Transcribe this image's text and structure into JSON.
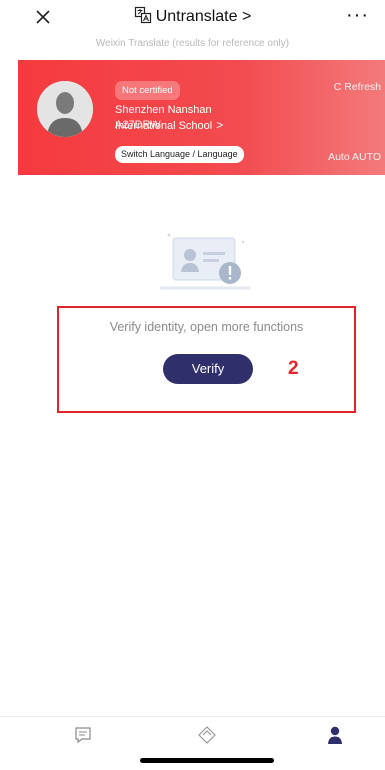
{
  "header": {
    "title": "Untranslate >",
    "subtitle": "Weixin Translate (results for reference only)",
    "close_icon": "close-icon",
    "menu_label": "···"
  },
  "banner": {
    "cert_status": "Not certified",
    "school_name": "Shenzhen Nanshan International School",
    "school_arrow": ">",
    "code": "A27DRW",
    "lang_switch": "Switch Language / Language",
    "refresh_label": "C Refresh",
    "auto_label": "Auto AUTO",
    "background_color": "#f53a3e"
  },
  "main": {
    "prompt_text": "Verify identity, open more functions",
    "verify_label": "Verify",
    "step_number": "2",
    "highlight_color": "#e0262a",
    "button_color": "#2f2f6b"
  },
  "bottom_nav": {
    "items": [
      {
        "icon": "message-icon",
        "label": ""
      },
      {
        "icon": "apps-icon",
        "label": ""
      },
      {
        "icon": "person-icon",
        "label": ""
      }
    ]
  }
}
